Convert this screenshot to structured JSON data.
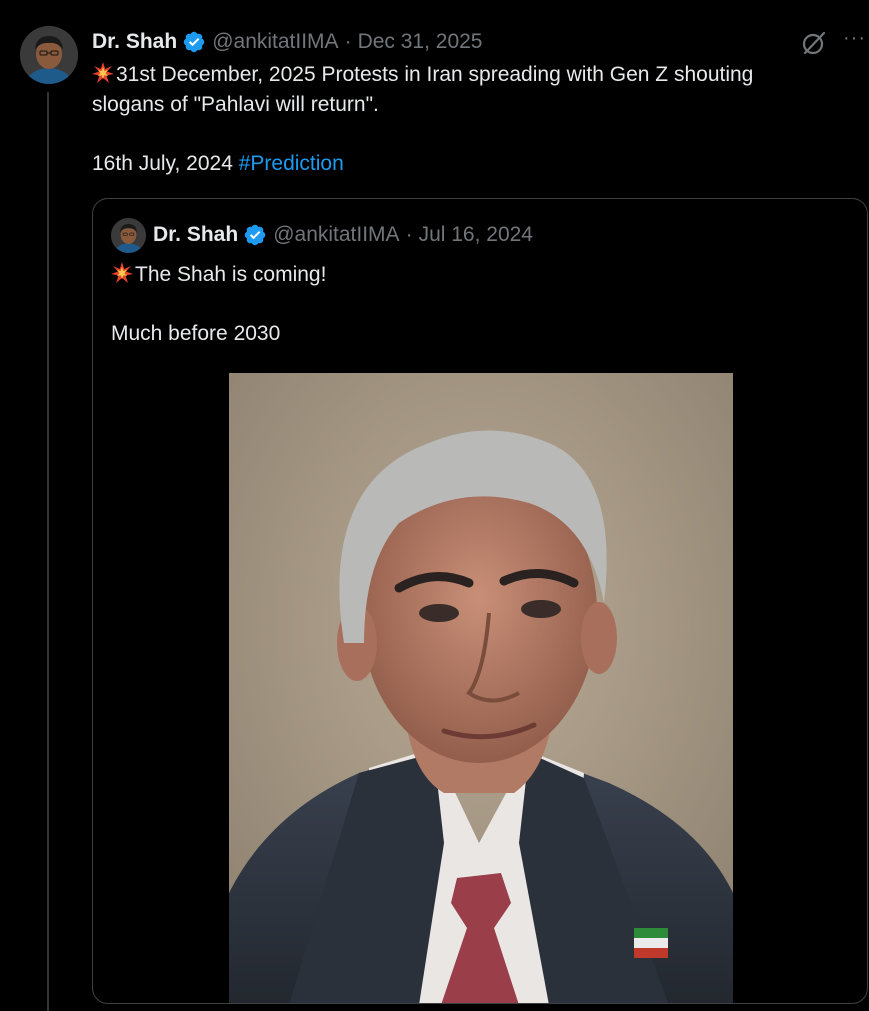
{
  "tweet": {
    "author_name": "Dr. Shah",
    "handle": "@ankitatIIMA",
    "separator": "·",
    "date": "Dec 31, 2025",
    "line1": "31st December, 2025 Protests in Iran spreading with Gen Z shouting",
    "line2": "slogans of \"Pahlavi will return\".",
    "line3_text": "16th July, 2024 ",
    "hashtag": "#Prediction"
  },
  "quoted_tweet": {
    "author_name": "Dr. Shah",
    "handle": "@ankitatIIMA",
    "separator": "·",
    "date": "Jul 16, 2024",
    "line1": "The Shah is coming!",
    "line2": "Much before 2030"
  },
  "icons": {
    "verified": "verified-badge-icon",
    "grok": "grok-icon",
    "more": "more-icon",
    "emoji": "collision-emoji"
  },
  "ui": {
    "more_glyph": "···"
  },
  "colors": {
    "background": "#000000",
    "text": "#e7e9ea",
    "muted": "#71767b",
    "link": "#1d9bf0",
    "verified": "#1d9bf0",
    "border": "#3e4144"
  }
}
